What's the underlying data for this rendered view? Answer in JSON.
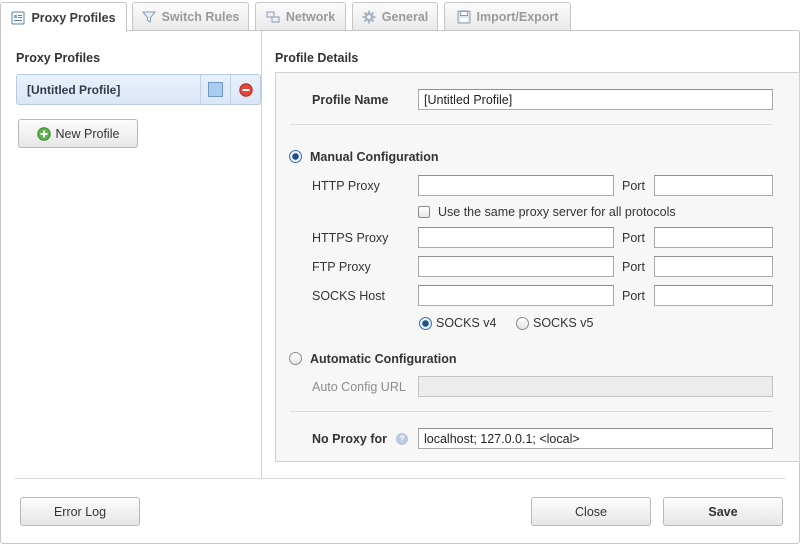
{
  "tabs": [
    {
      "label": "Proxy Profiles",
      "icon": "profiles-icon",
      "active": true
    },
    {
      "label": "Switch Rules",
      "icon": "filter-icon",
      "active": false
    },
    {
      "label": "Network",
      "icon": "network-icon",
      "active": false
    },
    {
      "label": "General",
      "icon": "gear-icon",
      "active": false
    },
    {
      "label": "Import/Export",
      "icon": "disk-icon",
      "active": false
    }
  ],
  "sidebar": {
    "title": "Proxy Profiles",
    "profiles": [
      {
        "name": "[Untitled Profile]",
        "color": "#a8cdf0"
      }
    ],
    "new_profile_label": "New Profile"
  },
  "details": {
    "title": "Profile Details",
    "profile_name_label": "Profile Name",
    "profile_name_value": "[Untitled Profile]",
    "manual_label": "Manual Configuration",
    "http_label": "HTTP Proxy",
    "https_label": "HTTPS Proxy",
    "ftp_label": "FTP Proxy",
    "socks_label": "SOCKS Host",
    "port_label": "Port",
    "same_proxy_label": "Use the same proxy server for all protocols",
    "socks_v4_label": "SOCKS v4",
    "socks_v5_label": "SOCKS v5",
    "auto_label": "Automatic Configuration",
    "auto_url_label": "Auto Config URL",
    "no_proxy_label": "No Proxy for",
    "no_proxy_value": "localhost; 127.0.0.1; <local>",
    "http_value": "",
    "http_port": "",
    "https_value": "",
    "https_port": "",
    "ftp_value": "",
    "ftp_port": "",
    "socks_value": "",
    "socks_port": "",
    "auto_url_value": ""
  },
  "footer": {
    "error_log_label": "Error Log",
    "close_label": "Close",
    "save_label": "Save"
  },
  "colors": {
    "selected_profile_bg": "#dbe6f6",
    "accent_radio": "#1f4f8a",
    "delete_red": "#d9342b",
    "add_green": "#4aa53a"
  }
}
